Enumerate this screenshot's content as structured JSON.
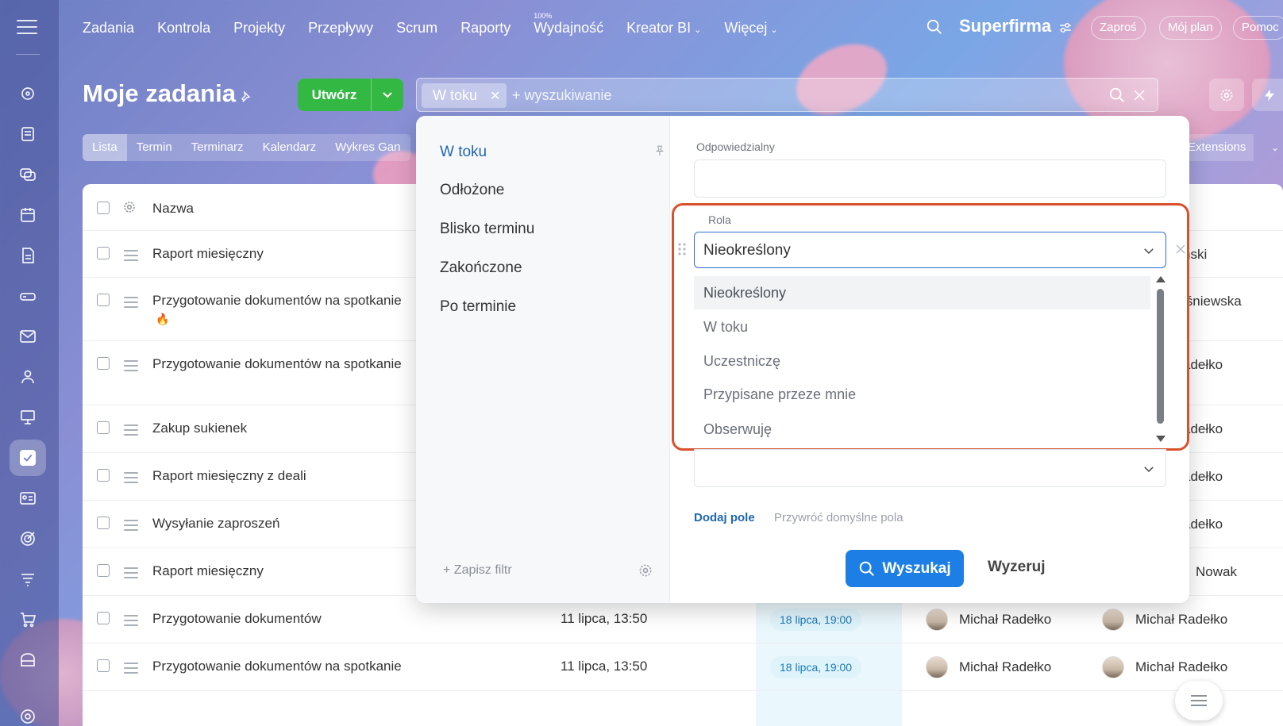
{
  "topnav": {
    "items": [
      "Zadania",
      "Kontrola",
      "Projekty",
      "Przepływy",
      "Scrum",
      "Raporty",
      "Wydajność",
      "Kreator BI",
      "Więcej"
    ],
    "efficiency_badge": "100%",
    "brand": "Superfirma",
    "invite": "Zaproś",
    "my_plan": "Mój plan",
    "help": "Pomoc"
  },
  "header": {
    "title": "Moje zadania",
    "create": "Utwórz",
    "filter_chip": "W toku",
    "search_placeholder": "+ wyszukiwanie"
  },
  "viewtabs": [
    "Lista",
    "Termin",
    "Terminarz",
    "Kalendarz",
    "Wykres Gan"
  ],
  "extensions": "Extensions",
  "table": {
    "col_name": "Nazwa",
    "rows": [
      {
        "name": "Raport miesięczny",
        "right": "ński"
      },
      {
        "name": "Przygotowanie dokumentów na spotkanie",
        "right": "iśniewska",
        "hot": "🔥"
      },
      {
        "name": "Przygotowanie dokumentów na spotkanie",
        "right": "adełko"
      },
      {
        "name": "Zakup sukienek",
        "right": "adełko"
      },
      {
        "name": "Raport miesięczny z deali",
        "right": "adełko"
      },
      {
        "name": "Wysyłanie zaproszeń",
        "right": "adełko"
      },
      {
        "name": "Raport miesięczny",
        "right": "Nowak"
      },
      {
        "name": "Przygotowanie dokumentów",
        "date": "11 lipca, 13:50",
        "deadline": "18 lipca, 19:00",
        "p1": "Michał Radełko",
        "p2": "Michał Radełko"
      },
      {
        "name": "Przygotowanie dokumentów na spotkanie",
        "date": "11 lipca, 13:50",
        "deadline": "18 lipca, 19:00",
        "p1": "Michał Radełko",
        "p2": "Michał Radełko"
      }
    ]
  },
  "popup": {
    "presets": [
      "W toku",
      "Odłożone",
      "Blisko terminu",
      "Zakończone",
      "Po terminie"
    ],
    "save_filter": "+ Zapisz filtr",
    "field_responsible": "Odpowiedzialny",
    "field_role": "Rola",
    "role_value": "Nieokreślony",
    "role_options": [
      "Nieokreślony",
      "W toku",
      "Uczestniczę",
      "Przypisane przeze mnie",
      "Obserwuję"
    ],
    "add_field": "Dodaj pole",
    "restore_fields": "Przywróć domyślne pola",
    "search": "Wyszukaj",
    "reset": "Wyzeruj"
  }
}
